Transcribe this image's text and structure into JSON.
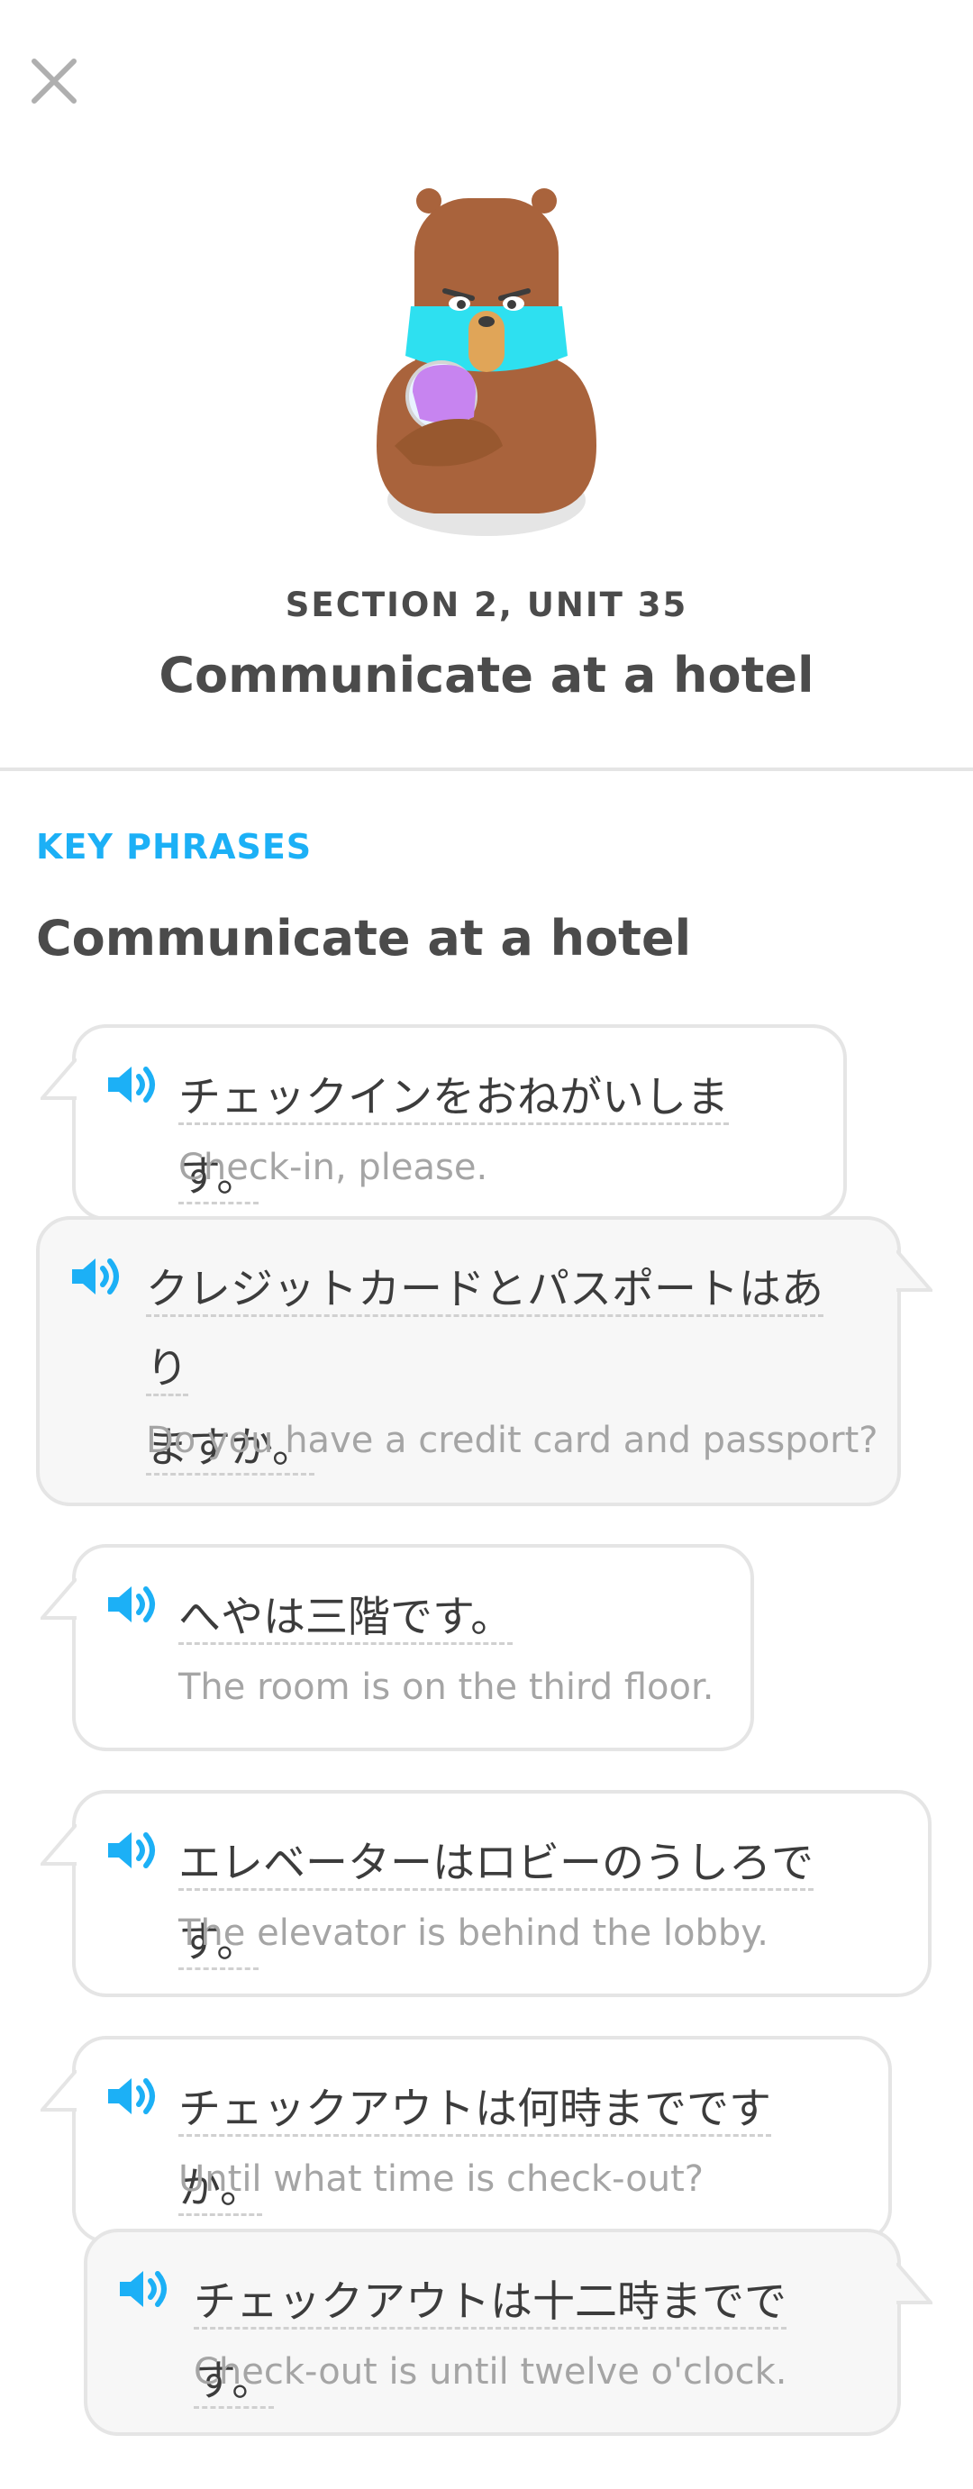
{
  "header": {
    "close_icon": "close-icon",
    "mascot": "bear-mascot-illustration",
    "section_label": "SECTION 2, UNIT 35",
    "unit_title": "Communicate at a hotel"
  },
  "key_phrases": {
    "label": "KEY PHRASES",
    "title": "Communicate at a hotel"
  },
  "phrases": [
    {
      "jp": "チェックインをおねがいします。",
      "en": "Check-in, please."
    },
    {
      "jp_line1": "クレジットカードとパスポートはあり",
      "jp_line2": "ますか。",
      "en": "Do you have a credit card and passport?"
    },
    {
      "jp": "へやは三階です。",
      "en": "The room is on the third floor."
    },
    {
      "jp": "エレベーターはロビーのうしろです。",
      "en": "The elevator is behind the lobby."
    },
    {
      "jp": "チェックアウトは何時までですか。",
      "en": "Until what time is check-out?"
    },
    {
      "jp": "チェックアウトは十二時までです。",
      "en": "Check-out is until twelve o'clock."
    }
  ],
  "colors": {
    "accent": "#1cb0f6",
    "text": "#4b4b4b",
    "muted": "#a5a5a5",
    "border": "#e5e5e5"
  }
}
